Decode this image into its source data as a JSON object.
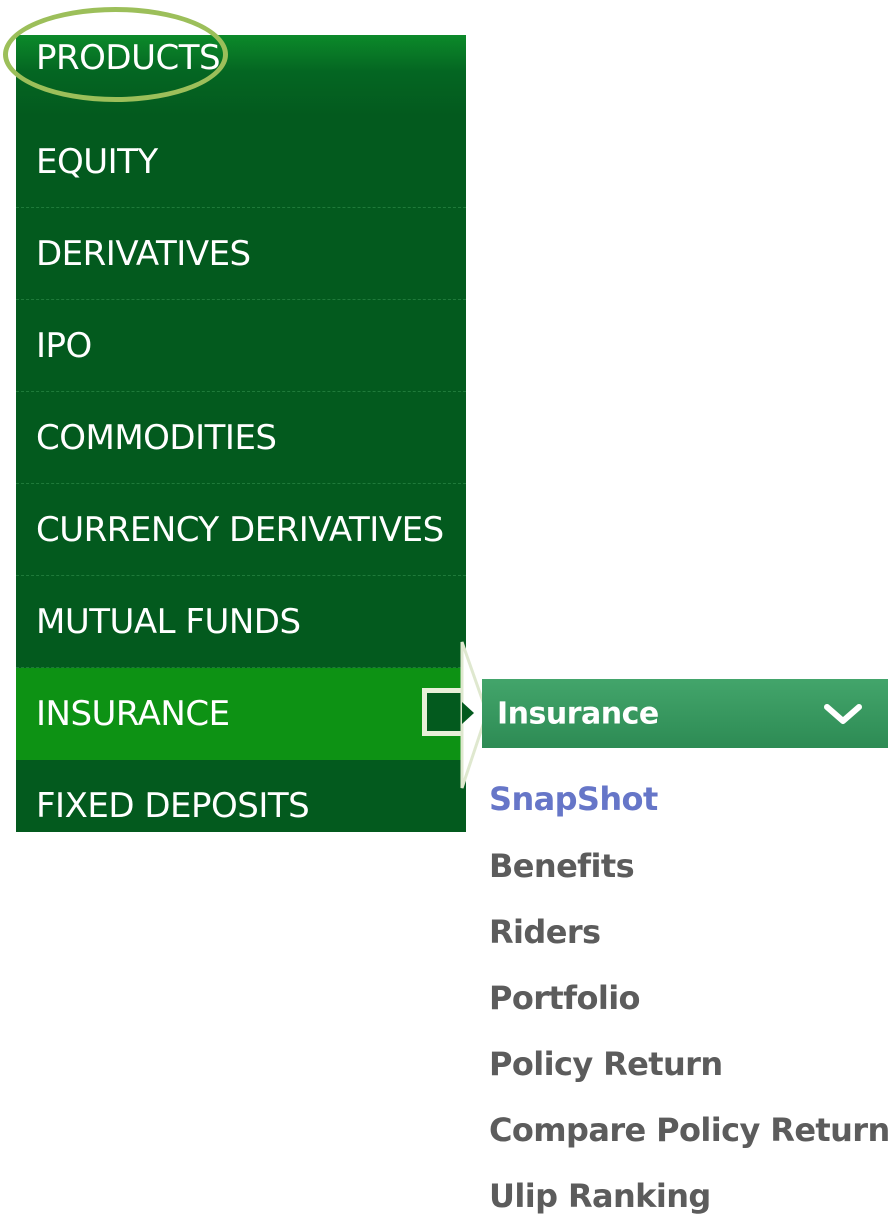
{
  "menu": {
    "header": "PRODUCTS",
    "items": [
      {
        "label": "EQUITY"
      },
      {
        "label": "DERIVATIVES"
      },
      {
        "label": "IPO"
      },
      {
        "label": "COMMODITIES"
      },
      {
        "label": "CURRENCY DERIVATIVES"
      },
      {
        "label": "MUTUAL FUNDS"
      },
      {
        "label": "INSURANCE",
        "active": true
      },
      {
        "label": "FIXED DEPOSITS"
      }
    ]
  },
  "submenu": {
    "title": "Insurance",
    "expand_icon": "chevron-down-icon",
    "links": [
      {
        "label": "SnapShot",
        "current": true
      },
      {
        "label": "Benefits"
      },
      {
        "label": "Riders"
      },
      {
        "label": "Portfolio"
      },
      {
        "label": "Policy Return"
      },
      {
        "label": "Compare Policy Return"
      },
      {
        "label": "Ulip Ranking"
      }
    ]
  },
  "colors": {
    "menu_bg": "#035a1e",
    "active_bg": "#0d9214",
    "submenu_header": "#3a9c62",
    "link_text": "#5c5c5c",
    "current_link": "#6676c8",
    "highlight_ring": "#9cbf5a"
  }
}
